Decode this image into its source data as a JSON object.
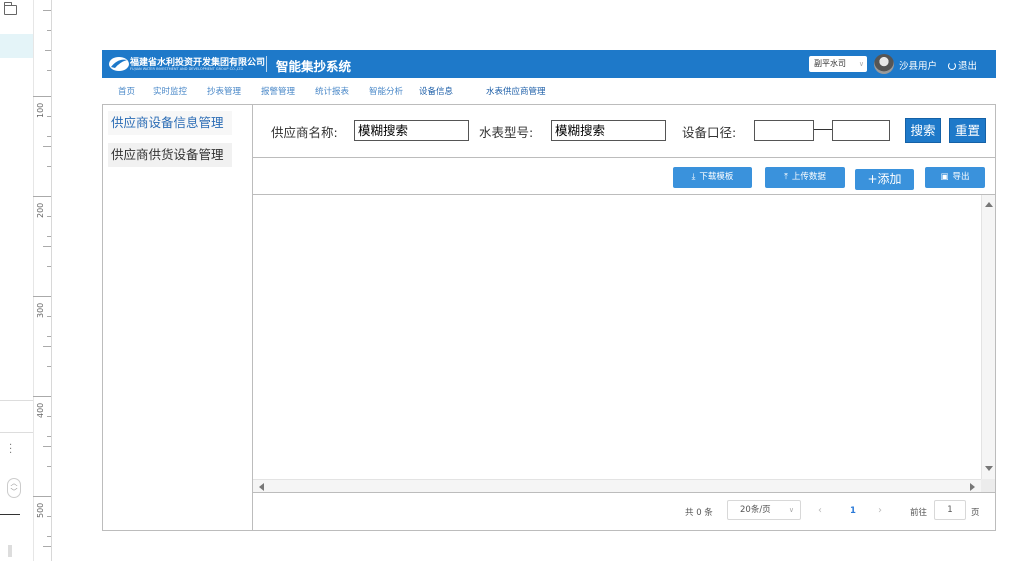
{
  "ruler": {
    "labels": [
      "100",
      "200",
      "300",
      "400",
      "500"
    ]
  },
  "header": {
    "org_name_cn": "福建省水利投资开发集团有限公司",
    "org_name_en": "FUJIAN WATER INVESTMENT AND DEVELOPMENT GROUP CO.,LTD",
    "system_title": "智能集抄系统",
    "company_select": "副平水司",
    "user_name": "沙县用户",
    "logout_label": "退出"
  },
  "nav": {
    "items": [
      "首页",
      "实时监控",
      "抄表管理",
      "报警管理",
      "统计报表",
      "智能分析",
      "设备信息",
      "水表供应商管理"
    ]
  },
  "sidebar": {
    "items": [
      "供应商设备信息管理",
      "供应商供货设备管理"
    ]
  },
  "filters": {
    "supplier_label": "供应商名称:",
    "supplier_value": "模糊搜索",
    "meter_model_label": "水表型号:",
    "meter_model_value": "模糊搜索",
    "caliber_label": "设备口径:",
    "caliber_from": "",
    "caliber_to": "",
    "search_button": "搜索",
    "reset_button": "重置"
  },
  "actions": {
    "download_template": "下载模板",
    "upload_data": "上传数据",
    "add": "+添加",
    "export": "导出"
  },
  "pagination": {
    "total_text": "共 0 条",
    "page_size": "20条/页",
    "current_page": "1",
    "goto_label": "前往",
    "goto_value": "1",
    "page_unit": "页"
  },
  "colors": {
    "primary": "#1e79c9",
    "action_button": "#3a92dc",
    "nav_text": "#4a88c8",
    "border": "#bcbcbc"
  }
}
